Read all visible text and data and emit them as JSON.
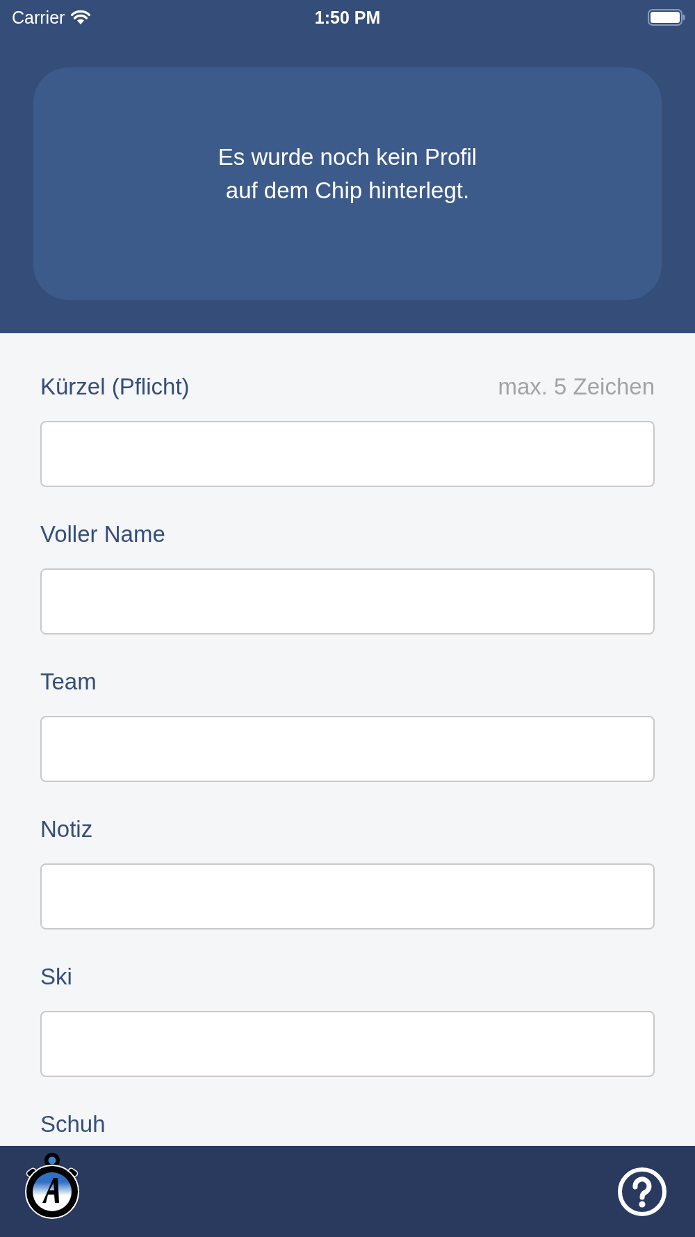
{
  "status_bar": {
    "carrier": "Carrier",
    "time": "1:50 PM"
  },
  "notice": {
    "text": "Es wurde noch kein Profil\nauf dem Chip hinterlegt."
  },
  "fields": [
    {
      "label": "Kürzel (Pflicht)",
      "hint": "max. 5 Zeichen"
    },
    {
      "label": "Voller Name"
    },
    {
      "label": "Team"
    },
    {
      "label": "Notiz"
    },
    {
      "label": "Ski"
    },
    {
      "label": "Schuh"
    }
  ]
}
